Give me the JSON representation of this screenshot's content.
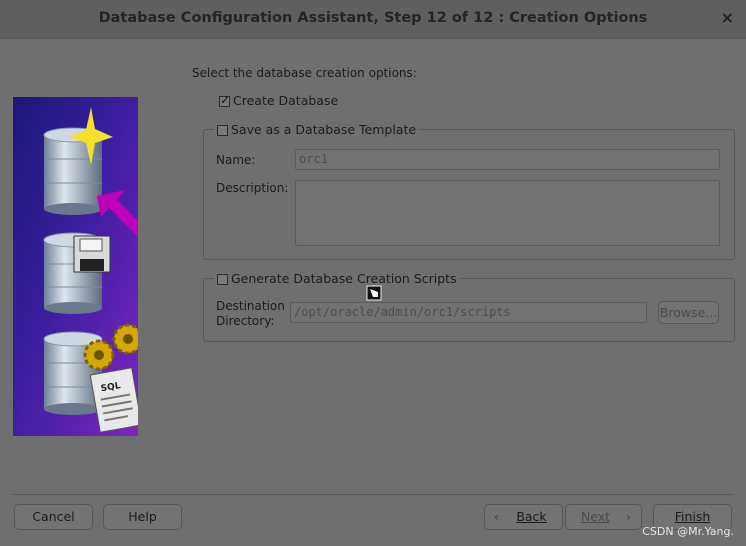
{
  "window": {
    "title": "Database Configuration Assistant, Step 12 of 12 : Creation Options",
    "close_symbol": "×"
  },
  "prompt": "Select the database creation options:",
  "create_database": {
    "label": "Create Database",
    "checked": true
  },
  "template_group": {
    "label": "Save as a Database Template",
    "checked": false,
    "name_label": "Name:",
    "name_value": "orc1",
    "description_label": "Description:",
    "description_value": ""
  },
  "scripts_group": {
    "label": "Generate Database Creation Scripts",
    "checked": false,
    "destination_label_line1": "Destination",
    "destination_label_line2": "Directory:",
    "destination_value": "/opt/oracle/admin/orc1/scripts",
    "browse_label": "Browse..."
  },
  "buttons": {
    "cancel": "Cancel",
    "help": "Help",
    "back": "Back",
    "next": "Next",
    "finish": "Finish"
  },
  "image_text": {
    "sql": "SQL"
  },
  "watermark": "CSDN @Mr.Yang.",
  "colors": {
    "panel_gradient_top": "#1f1a86",
    "panel_gradient_bottom": "#8a2ad0",
    "arrow": "#c000b8",
    "star": "#f3e12a"
  }
}
